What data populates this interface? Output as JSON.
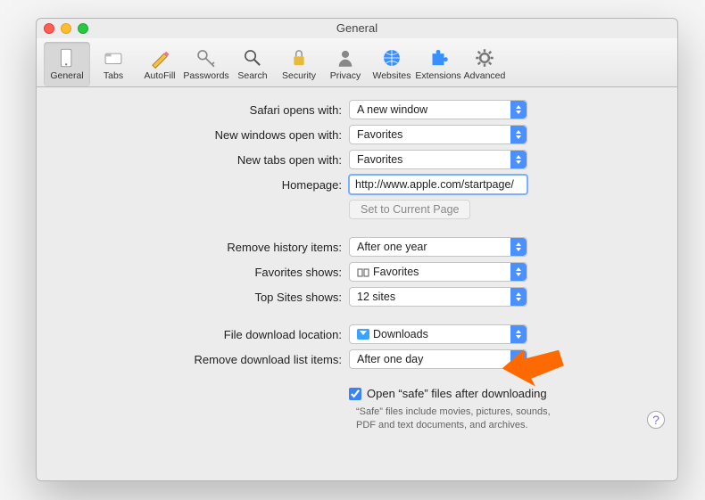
{
  "window": {
    "title": "General"
  },
  "toolbar": {
    "items": [
      {
        "label": "General"
      },
      {
        "label": "Tabs"
      },
      {
        "label": "AutoFill"
      },
      {
        "label": "Passwords"
      },
      {
        "label": "Search"
      },
      {
        "label": "Security"
      },
      {
        "label": "Privacy"
      },
      {
        "label": "Websites"
      },
      {
        "label": "Extensions"
      },
      {
        "label": "Advanced"
      }
    ]
  },
  "labels": {
    "safari_opens": "Safari opens with:",
    "new_windows": "New windows open with:",
    "new_tabs": "New tabs open with:",
    "homepage": "Homepage:",
    "set_current": "Set to Current Page",
    "remove_history": "Remove history items:",
    "favorites_shows": "Favorites shows:",
    "top_sites": "Top Sites shows:",
    "download_loc": "File download location:",
    "remove_dl": "Remove download list items:",
    "open_safe": "Open “safe” files after downloading",
    "safe_hint": "“Safe” files include movies, pictures, sounds, PDF and text documents, and archives."
  },
  "values": {
    "safari_opens": "A new window",
    "new_windows": "Favorites",
    "new_tabs": "Favorites",
    "homepage": "http://www.apple.com/startpage/",
    "remove_history": "After one year",
    "favorites_shows": "Favorites",
    "top_sites": "12 sites",
    "download_loc": "Downloads",
    "remove_dl": "After one day",
    "open_safe_checked": true
  },
  "help": "?"
}
